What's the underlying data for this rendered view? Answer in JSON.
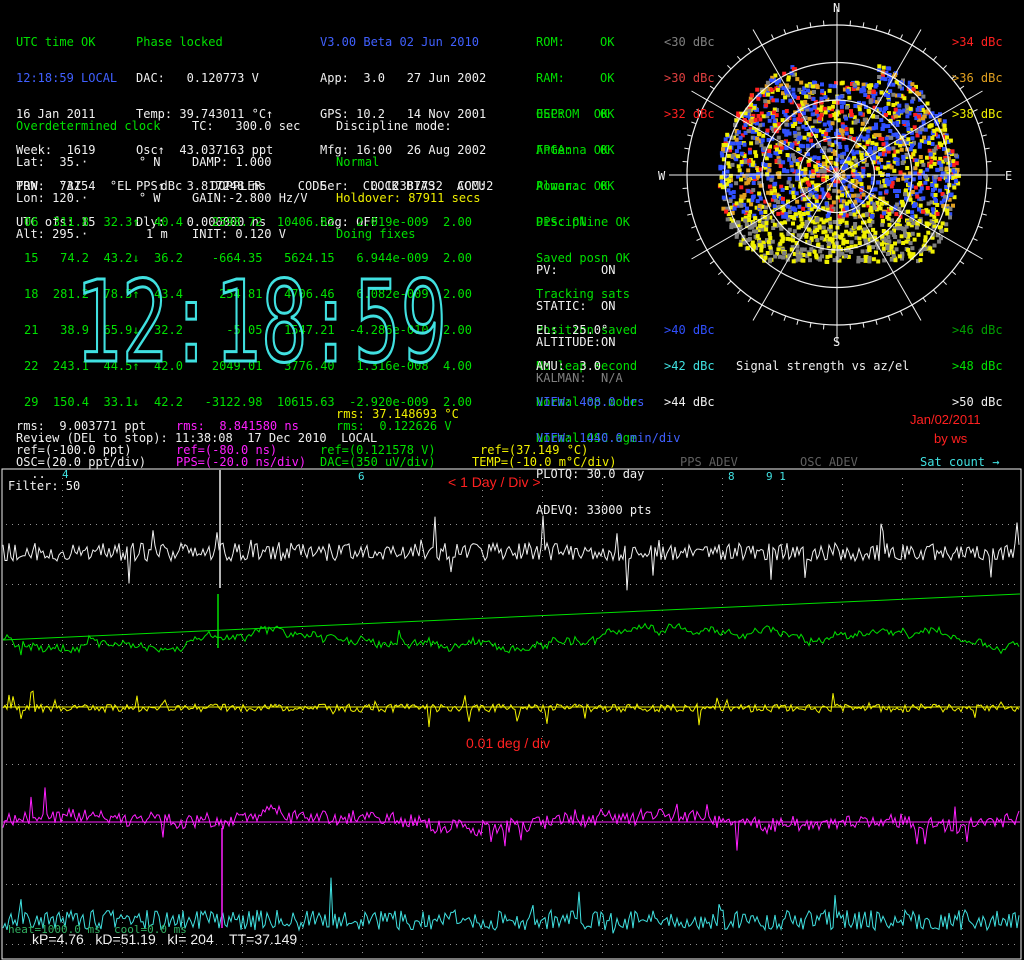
{
  "status": {
    "utc_ok": "UTC time OK",
    "time_local": "12:18:59 LOCAL",
    "date": "16 Jan 2011",
    "week": "Week:  1619",
    "tow": "TOW:  73154",
    "utc_ofs": "UTC ofs: 15"
  },
  "phase": {
    "title": "Phase locked",
    "dac": "DAC:   0.120773 V",
    "temp": "Temp: 39.743011 °C↑",
    "osc": "Osc↑  43.037163 ppt",
    "pps": "PPS↑   3.817248 ns",
    "dly": "Dly:   0.000000 ns"
  },
  "version": {
    "title": "V3.00 Beta 02 Jun 2010",
    "app": "App:  3.0   27 Jun 2002",
    "gps": "GPS: 10.2   14 Nov 2001",
    "mfg": "Mfg: 16:00  26 Aug 2002",
    "ser": "Ser:   0.12387732  COM:2",
    "log": "Log: OFF"
  },
  "checks": [
    {
      "label": "ROM:",
      "val": "OK"
    },
    {
      "label": "RAM:",
      "val": "OK"
    },
    {
      "label": "OSC:",
      "val": "OK"
    },
    {
      "label": "FPGA:",
      "val": "OK"
    },
    {
      "label": "Power:",
      "val": "OK"
    }
  ],
  "status_list": [
    "EEPROM  OK",
    "Antenna OK",
    "Almanac OK",
    "Discipline OK",
    "Saved posn OK",
    "Tracking sats",
    "Position saved",
    "No leap second",
    "Normal op mode",
    "Normal OSC age"
  ],
  "pps_on": "PPS: ON",
  "modes": [
    "PV:      ON",
    "STATIC:  ON",
    "ALTITUDE:ON"
  ],
  "kalman": "KALMAN:  N/A",
  "el": "EL:  25.0°",
  "amu": "AMU:  3.0",
  "position": {
    "title": "Overdetermined clock",
    "lat": "Lat:  35.·       ° N",
    "lon": "Lon: 120.·       ° W",
    "alt": "Alt: 295.·        1 m"
  },
  "tc": {
    "tc": "TC:   300.0 sec",
    "damp": "DAMP: 1.000",
    "gain": "GAIN:-2.800 Hz/V",
    "init": "INIT: 0.120 V"
  },
  "discipline": {
    "title": "Discipline mode:",
    "normal": "Normal",
    "holdover": "Holdover: 87911 secs",
    "fixes": "Doing fixes"
  },
  "sat_table": {
    "headers": "PRN   °AZ    °EL    dBc    DOPPLER     CODE     CLOCK BIAS   ACCU",
    "rows": [
      "06  311.8  32.3↑  40.4    2598.72  10406.82   2.019e-009  2.00",
      "15   74.2  43.2↓  36.2    -664.35   5624.15   6.944e-009  2.00",
      "18  281.2  78.5↑  43.4     254.81   4706.46   6.082e-009  2.00",
      "21   38.9  65.9↓  32.2      -5.05   1547.21  -4.286e-010  2.00",
      "22  243.1  44.5↑  42.0    2049.01   3776.40   1.316e-008  4.00",
      "29  150.4  33.1↓  42.2   -3122.98  10615.63  -2.920e-009  2.00"
    ],
    "extra": [
      " ..",
      " .."
    ]
  },
  "big_time": "12:18:59",
  "legend_left": [
    {
      "text": "<30 dBc",
      "color": "#808080"
    },
    {
      "text": ">30 dBc",
      "color": "#e04040"
    },
    {
      "text": ">32 dBc",
      "color": "#ff2020"
    }
  ],
  "legend_right": [
    {
      "text": ">34 dBc",
      "color": "#ff2020"
    },
    {
      "text": ">36 dBc",
      "color": "#e0a020"
    },
    {
      "text": ">38 dBc",
      "color": "#f0f000"
    }
  ],
  "legend_bl": [
    {
      "text": ">40 dBc",
      "color": "#3050ff"
    },
    {
      "text": ">42 dBc",
      "color": "#40e0e0"
    },
    {
      "text": ">44 dBc",
      "color": "#f0f0f0"
    }
  ],
  "legend_br": [
    {
      "text": ">46 dBc",
      "color": "#00a000"
    },
    {
      "text": ">48 dBc",
      "color": "#00e000"
    },
    {
      "text": ">50 dBc",
      "color": "#f0f0f0"
    }
  ],
  "compass": {
    "n": "N",
    "s": "S",
    "e": "E",
    "w": "W"
  },
  "polar_caption": "Signal strength vs az/el",
  "view": {
    "hrs": "VIEW: 408.0 hrs",
    "min": "VIEW: 1440.0 min/div",
    "plotq": "PLOTQ: 30.0 day",
    "adevq": "ADEVQ: 33000 pts"
  },
  "rms": {
    "temp_rms": "rms: 37.148693 °C",
    "dac_rms": "rms:  0.122626 V",
    "osc_rms": "rms:  9.003771 ppt",
    "pps_rms_label": "rms:",
    "pps_rms_val": "  8.841580 ns"
  },
  "review": "Review (DEL to stop): 11:38:08  17 Dec 2010  LOCAL",
  "refs": {
    "osc_ref": "ref=(-100.0 ppt)",
    "pps_ref": "ref=(-80.0 ns)",
    "dac_ref": "ref=(0.121578 V)",
    "temp_ref": "ref=(37.149 °C)"
  },
  "scales": {
    "osc": "OSC=(20.0 ppt/div)",
    "pps": "PPS=(-20.0 ns/div)",
    "dac": "DAC=(350 uV/div)",
    "temp": "TEMP=(-10.0 m°C/div)"
  },
  "tabs": {
    "pps_adev": "PPS ADEV",
    "osc_adev": "OSC ADEV",
    "sat_count": "Sat count"
  },
  "annotation": {
    "date": "Jan/02/2011",
    "by": "by ws"
  },
  "filter": "Filter: 50",
  "day_div": "< 1 Day / Div >",
  "deg_div": "0.01 deg / div",
  "sat_marks": [
    "4",
    "6",
    "8",
    "9 1"
  ],
  "bottom": {
    "faint": "heat=1000.0 ms  cool=0.0 ms",
    "params": "kP=4.76   kD=51.19   kI= 204    TT=37.149"
  }
}
